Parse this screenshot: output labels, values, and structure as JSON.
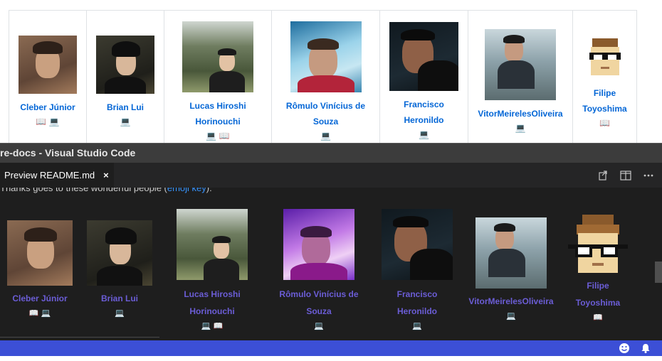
{
  "web_page": {
    "contributors": [
      {
        "name": "Cleber Júnior",
        "icons": "📖 💻"
      },
      {
        "name": "Brian Lui",
        "icons": "💻"
      },
      {
        "name": "Lucas Hiroshi Horinouchi",
        "icons": "💻 📖"
      },
      {
        "name": "Rômulo Vinícius de Souza",
        "icons": "💻"
      },
      {
        "name": "Francisco Heronildo",
        "icons": "💻"
      },
      {
        "name": "VitorMeirelesOliveira",
        "icons": "💻"
      },
      {
        "name": "Filipe Toyoshima",
        "icons": "📖"
      }
    ]
  },
  "vscode": {
    "window_title": "re-docs - Visual Studio Code",
    "tab": {
      "label": "Preview README.md",
      "close_glyph": "×"
    },
    "tab_actions": {
      "open_source_icon": "open-source-icon",
      "split_editor_icon": "split-editor-icon",
      "more_actions_icon": "more-actions-icon"
    },
    "preview": {
      "intro_before": "Thanks goes to these wonderful people (",
      "intro_link": "emoji key",
      "intro_after": "):",
      "contributors": [
        {
          "name": "Cleber Júnior",
          "icons": "📖 💻"
        },
        {
          "name": "Brian Lui",
          "icons": "💻"
        },
        {
          "name": "Lucas Hiroshi Horinouchi",
          "icons": "💻 📖"
        },
        {
          "name": "Rômulo Vinícius de Souza",
          "icons": "💻"
        },
        {
          "name": "Francisco Heronildo",
          "icons": "💻"
        },
        {
          "name": "VitorMeirelesOliveira",
          "icons": "💻"
        },
        {
          "name": "Filipe Toyoshima",
          "icons": "📖"
        }
      ]
    },
    "statusbar": {
      "feedback_icon": "smiley-icon",
      "notifications_icon": "bell-icon",
      "color": "#3c4fd6"
    }
  }
}
